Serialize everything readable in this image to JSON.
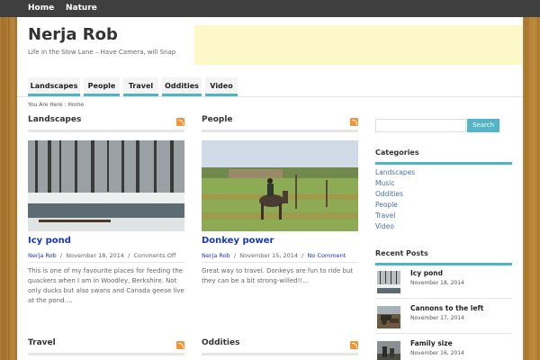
{
  "topnav": {
    "items": [
      "Home",
      "Nature"
    ]
  },
  "site": {
    "title": "Nerja Rob",
    "description": "Life in the Slow Lane – Have Camera, will Snap"
  },
  "mainnav": {
    "items": [
      "Landscapes",
      "People",
      "Travel",
      "Oddities",
      "Video"
    ]
  },
  "breadcrumb": {
    "prefix": "You Are Here :",
    "current": "Home"
  },
  "columns": {
    "landscapes": {
      "title": "Landscapes",
      "post": {
        "title": "Icy pond",
        "author": "Nerja Rob",
        "date": "November 18, 2014",
        "comments": "Comments Off",
        "excerpt": "This is one of my favourite places for feeding the quackers when I am in Woodley, Berkshire. Not only ducks but also swans and Canada geese live at the pond…."
      }
    },
    "people": {
      "title": "People",
      "post": {
        "title": "Donkey power",
        "author": "Nerja Rob",
        "date": "November 15, 2014",
        "comments": "No Comment",
        "excerpt": "Great way to travel. Donkeys are fun to ride but they can be a bit strong-willed!!…"
      }
    },
    "travel": {
      "title": "Travel"
    },
    "oddities": {
      "title": "Oddities"
    }
  },
  "sidebar": {
    "search_label": "Search",
    "categories_title": "Categories",
    "categories": [
      "Landscapes",
      "Music",
      "Oddities",
      "People",
      "Travel",
      "Video"
    ],
    "recent_title": "Recent Posts",
    "recent": [
      {
        "title": "Icy pond",
        "date": "November 18, 2014"
      },
      {
        "title": "Cannons to the left",
        "date": "November 17, 2014"
      },
      {
        "title": "Family size",
        "date": "November 16, 2014"
      }
    ]
  },
  "colors": {
    "accent": "#4db6c4",
    "link": "#1a37b8",
    "ad_background": "#fdf8c8"
  }
}
